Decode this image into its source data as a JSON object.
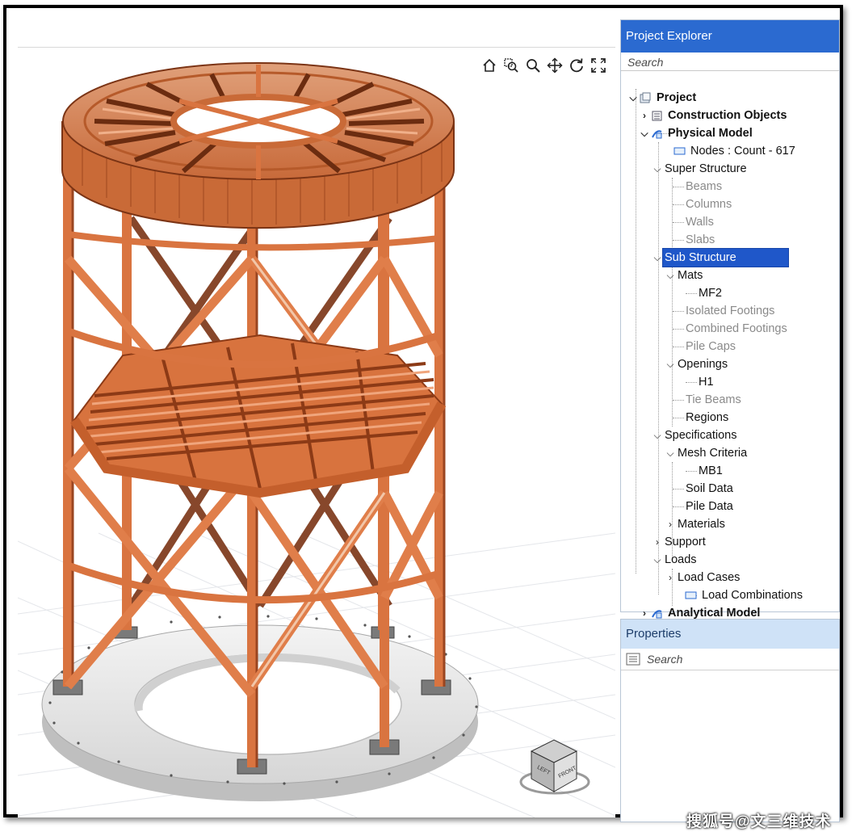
{
  "viewport": {
    "toolbar": [
      {
        "name": "home-icon"
      },
      {
        "name": "zoom-window-icon"
      },
      {
        "name": "zoom-icon"
      },
      {
        "name": "pan-icon"
      },
      {
        "name": "rotate-icon"
      },
      {
        "name": "fit-all-icon"
      }
    ],
    "viewcube": {
      "left_label": "LEFT",
      "front_label": "FRONT"
    }
  },
  "project_explorer": {
    "title": "Project Explorer",
    "search_placeholder": "Search",
    "tree": {
      "project": "Project",
      "construction_objects": "Construction Objects",
      "physical_model": "Physical Model",
      "nodes": "Nodes : Count - 617",
      "super_structure": "Super Structure",
      "beams": "Beams",
      "columns": "Columns",
      "walls": "Walls",
      "slabs": "Slabs",
      "sub_structure": "Sub Structure",
      "mats": "Mats",
      "mf2": "MF2",
      "isolated_footings": "Isolated Footings",
      "combined_footings": "Combined Footings",
      "pile_caps": "Pile Caps",
      "openings": "Openings",
      "h1": "H1",
      "tie_beams": "Tie Beams",
      "regions": "Regions",
      "specifications": "Specifications",
      "mesh_criteria": "Mesh Criteria",
      "mb1": "MB1",
      "soil_data": "Soil Data",
      "pile_data": "Pile Data",
      "materials": "Materials",
      "support": "Support",
      "loads": "Loads",
      "load_cases": "Load Cases",
      "load_combinations": "Load Combinations",
      "analytical_model": "Analytical Model"
    }
  },
  "properties": {
    "title": "Properties",
    "search_placeholder": "Search"
  },
  "watermark": "搜狐号@文三维技术",
  "colors": {
    "steel": "#d9753f",
    "steel_dark": "#8c3a16",
    "accent": "#2b6ad0",
    "selection": "#1f57c9"
  }
}
